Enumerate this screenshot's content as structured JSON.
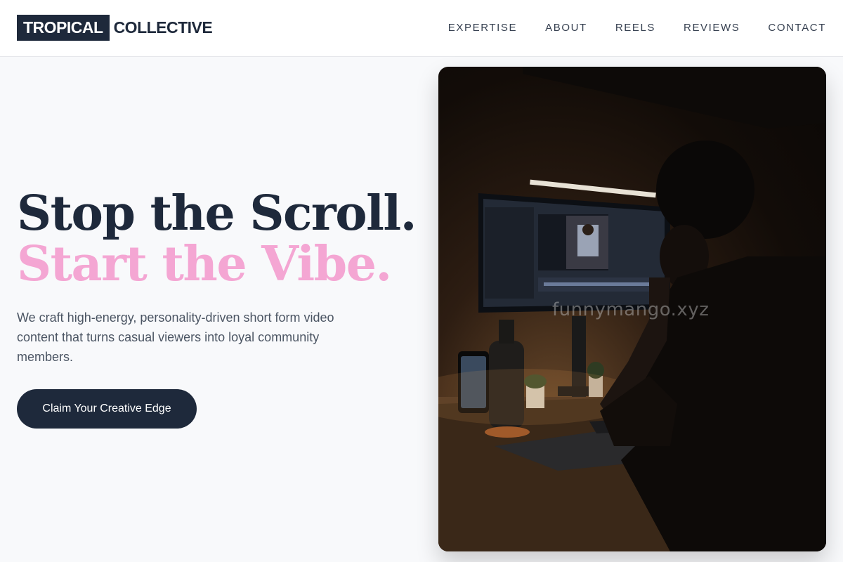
{
  "brand": {
    "box_text": "TROPICAL",
    "text": "COLLECTIVE"
  },
  "nav": {
    "items": [
      {
        "label": "EXPERTISE"
      },
      {
        "label": "ABOUT"
      },
      {
        "label": "REELS"
      },
      {
        "label": "REVIEWS"
      },
      {
        "label": "CONTACT"
      }
    ]
  },
  "hero": {
    "title_line1": "Stop the Scroll.",
    "title_line2": "Start the Vibe.",
    "description": "We craft high-energy, personality-driven short form video content that turns casual viewers into loyal community members.",
    "cta_label": "Claim Your Creative Edge"
  },
  "image": {
    "alt": "Person editing video at a desk in a dim room",
    "watermark": "funnymango.xyz"
  },
  "colors": {
    "primary": "#1e293b",
    "accent_pink": "#f4a6d3",
    "background": "#f8f9fb"
  }
}
